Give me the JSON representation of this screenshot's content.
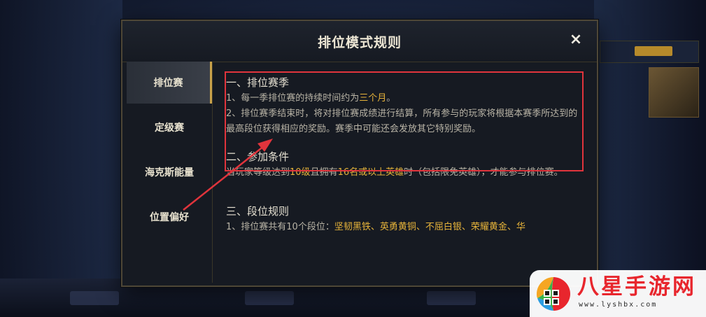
{
  "dialog": {
    "title": "排位模式规则",
    "close_label": "×"
  },
  "sidebar": {
    "items": [
      {
        "label": "排位赛",
        "active": true
      },
      {
        "label": "定级赛",
        "active": false
      },
      {
        "label": "海克斯能量",
        "active": false
      },
      {
        "label": "位置偏好",
        "active": false
      }
    ]
  },
  "content": {
    "s1": {
      "title": "一、排位赛季",
      "p1_a": "1、每一季排位赛的持续时间约为",
      "p1_hl": "三个月",
      "p1_b": "。",
      "p2": "2、排位赛季结束时，将对排位赛成绩进行结算，所有参与的玩家将根据本赛季所达到的最高段位获得相应的奖励。赛季中可能还会发放其它特别奖励。"
    },
    "s2": {
      "title": "二、参加条件",
      "p_a": "当玩家等级达到",
      "p_hl1": "10级",
      "p_b": "且拥有",
      "p_hl2": "16名或以上英雄",
      "p_c": "时（包括限免英雄），才能参与排位赛。"
    },
    "s3": {
      "title": "三、段位规则",
      "p_a": "1、排位赛共有10个段位：",
      "p_hl": "坚韧黑铁、英勇黄铜、不屈白银、荣耀黄金、华"
    }
  },
  "watermark": {
    "title": "八星手游网",
    "url": "www.lyshbx.com"
  },
  "colors": {
    "highlight": "#e6b33a",
    "annotation": "#e0343c",
    "accent_gold": "#c9a24a"
  }
}
